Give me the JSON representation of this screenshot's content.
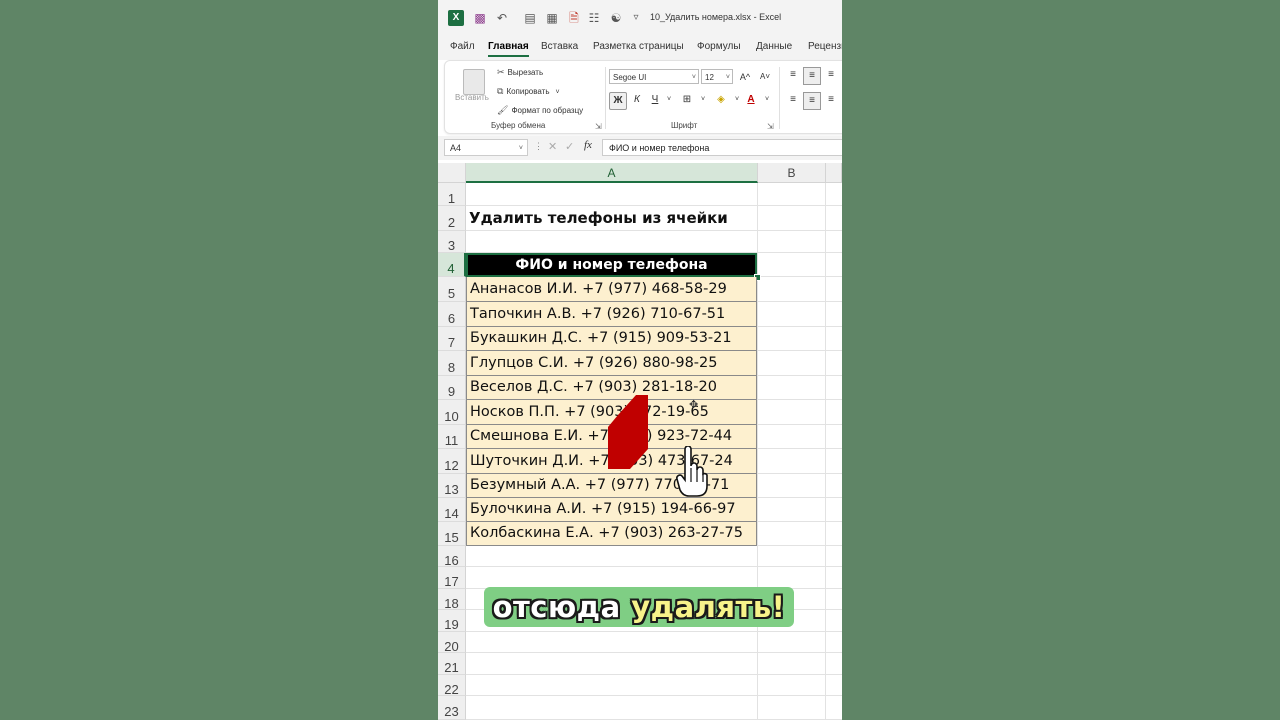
{
  "window": {
    "filename": "10_Удалить номера.xlsx",
    "separator": "-",
    "app_name": "Excel"
  },
  "ribbon_tabs": [
    "Файл",
    "Главная",
    "Вставка",
    "Разметка страницы",
    "Формулы",
    "Данные",
    "Рецензи"
  ],
  "active_tab": "Главная",
  "clipboard": {
    "paste_label": "Вставить",
    "cut_label": "Вырезать",
    "copy_label": "Копировать",
    "format_painter_label": "Формат по образцу",
    "group_label": "Буфер обмена"
  },
  "font": {
    "family_value": "Segoe UI",
    "size_value": "12",
    "grow_label": "A^",
    "shrink_label": "A˅",
    "bold_label": "Ж",
    "italic_label": "К",
    "underline_label": "Ч",
    "color_label": "A",
    "group_label": "Шрифт"
  },
  "formula_bar": {
    "name_box": "A4",
    "fx_label": "fx",
    "content": "ФИО и номер телефона"
  },
  "columns": [
    "A",
    "B"
  ],
  "rows": [
    "1",
    "2",
    "3",
    "4",
    "5",
    "6",
    "7",
    "8",
    "9",
    "10",
    "11",
    "12",
    "13",
    "14",
    "15",
    "16",
    "17",
    "18",
    "19",
    "20",
    "21",
    "22",
    "23"
  ],
  "sheet": {
    "title": "Удалить телефоны из ячейки",
    "header": "ФИО и номер телефона",
    "entries": [
      "Ананасов И.И. +7 (977) 468-58-29",
      "Тапочкин А.В. +7 (926) 710-67-51",
      "Букашкин Д.С. +7 (915) 909-53-21",
      "Глупцов С.И. +7 (926) 880-98-25",
      "Веселов Д.С. +7 (903) 281-18-20",
      "Носков П.П. +7 (903) 172-19-65",
      "Смешнова Е.И. +7 (903) 923-72-44",
      "Шуточкин Д.И. +7 (903) 473-67-24",
      "Безумный А.А. +7 (977) 770-15-71",
      "Булочкина А.И. +7 (915) 194-66-97",
      "Колбаскина Е.А. +7 (903) 263-27-75"
    ]
  },
  "caption": {
    "part1": "отсюда",
    "part2": "удалять!"
  },
  "colors": {
    "background": "#5f8566",
    "excel_green": "#1d6f42",
    "data_fill": "#fdf0cf",
    "header_fill": "#000000",
    "marker": "#c00000",
    "caption_bg": "#7fce84",
    "caption_highlight": "#f7f38a"
  }
}
